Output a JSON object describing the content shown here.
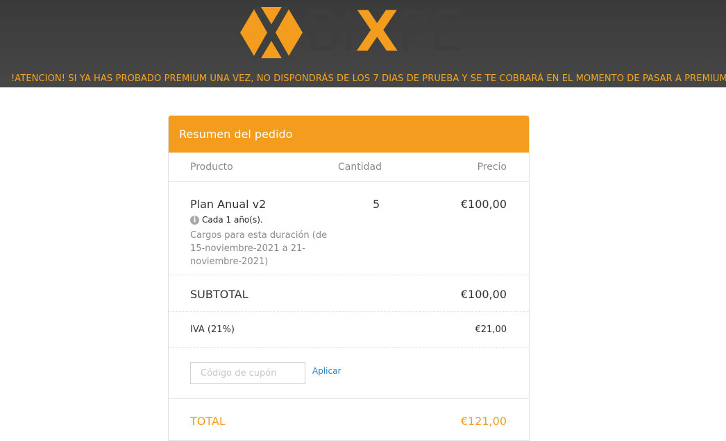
{
  "brand": {
    "logo_prefix": "BI",
    "logo_accent": "X",
    "logo_suffix": "PE",
    "accent_color": "#f39c1d"
  },
  "banner": {
    "warning": "!ATENCION! SI YA HAS PROBADO PREMIUM UNA VEZ, NO DISPONDRÁS DE LOS 7 DIAS DE PRUEBA Y SE TE COBRARÁ EN EL  MOMENTO DE PASAR A PREMIUM"
  },
  "order": {
    "title": "Resumen del pedido",
    "columns": {
      "product": "Producto",
      "quantity": "Cantidad",
      "price": "Precio"
    },
    "item": {
      "name": "Plan Anual v2",
      "quantity": "5",
      "price": "€100,00",
      "billing_icon": "info-icon",
      "billing_cycle": "Cada 1 año(s).",
      "charges_note": "Cargos para esta duración (de 15-noviembre-2021 a 21-noviembre-2021)"
    },
    "subtotal": {
      "label": "SUBTOTAL",
      "value": "€100,00"
    },
    "tax": {
      "label": "IVA (21%)",
      "value": "€21,00"
    },
    "coupon": {
      "placeholder": "Código de cupón",
      "apply_label": "Aplicar"
    },
    "total": {
      "label": "TOTAL",
      "value": "€121,00"
    }
  }
}
